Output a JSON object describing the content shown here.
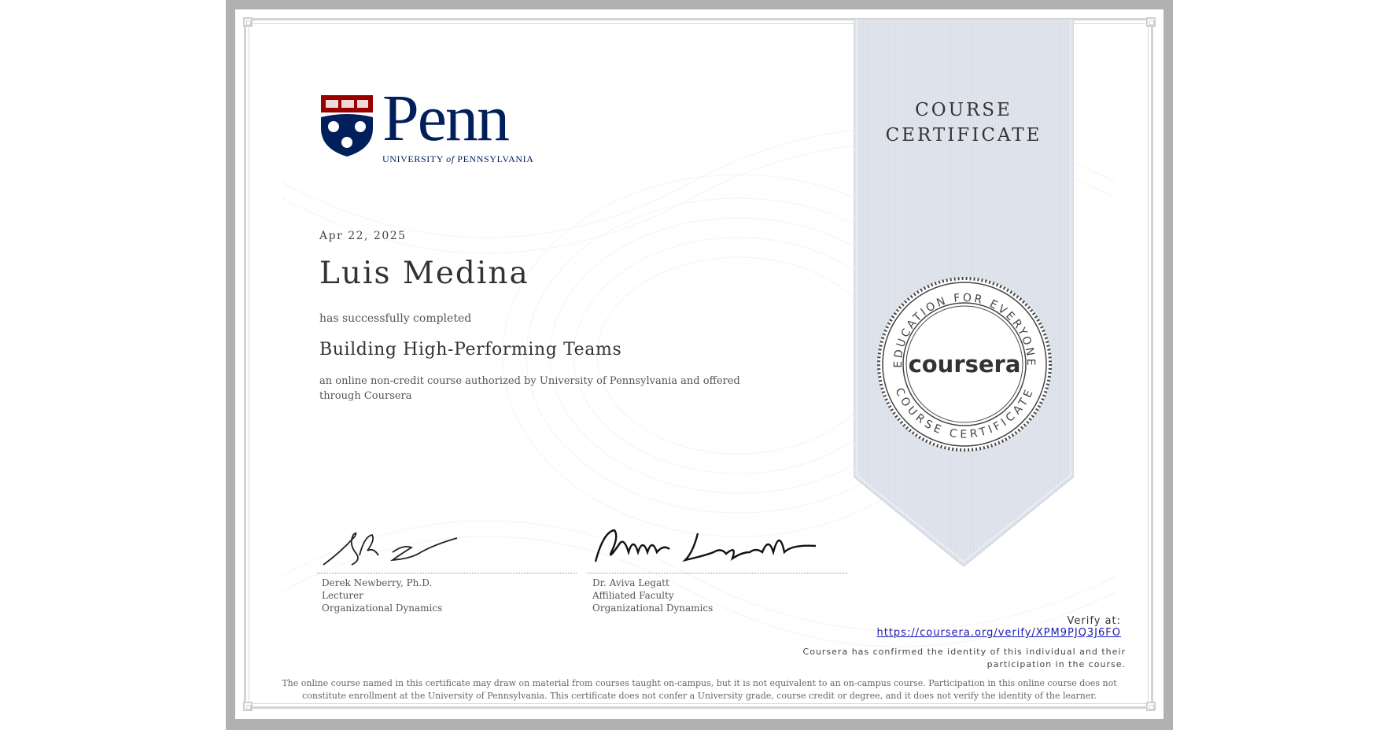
{
  "ribbon": {
    "line1": "COURSE",
    "line2": "CERTIFICATE"
  },
  "seal": {
    "top_text": "EDUCATION FOR EVERYONE",
    "bottom_text": "COURSE CERTIFICATE",
    "brand": "coursera"
  },
  "logo": {
    "wordmark": "Penn",
    "subtitle_a": "UNIVERSITY ",
    "subtitle_of": "of",
    "subtitle_b": " PENNSYLVANIA"
  },
  "certificate": {
    "date": "Apr 22, 2025",
    "recipient": "Luis Medina",
    "completed_text": "has successfully completed",
    "course_name": "Building High-Performing Teams",
    "authorization": "an online non-credit course authorized by University of Pennsylvania and offered through Coursera"
  },
  "signatures": [
    {
      "name": "Derek Newberry, Ph.D.",
      "title": "Lecturer",
      "department": "Organizational Dynamics"
    },
    {
      "name": "Dr. Aviva Legatt",
      "title": "Affiliated Faculty",
      "department": "Organizational Dynamics"
    }
  ],
  "verify": {
    "label": "Verify at:",
    "url": "https://coursera.org/verify/XPM9PJQ3J6FO"
  },
  "identity_note": "Coursera has confirmed the identity of this individual and their participation in the course.",
  "disclaimer": "The online course named in this certificate may draw on material from courses taught on-campus, but it is not equivalent to an on-campus course. Participation in this online course does not constitute enrollment at the University of Pennsylvania. This certificate does not confer a University grade, course credit or degree, and it does not verify the identity of the learner.",
  "colors": {
    "penn_blue": "#011f5b",
    "penn_red": "#990000",
    "ribbon": "#dfe4ec",
    "frame": "#b1b1b1",
    "link": "#1a1ab5"
  },
  "icons": {
    "logo_shield": "penn-shield-icon",
    "seal": "coursera-seal-icon"
  }
}
